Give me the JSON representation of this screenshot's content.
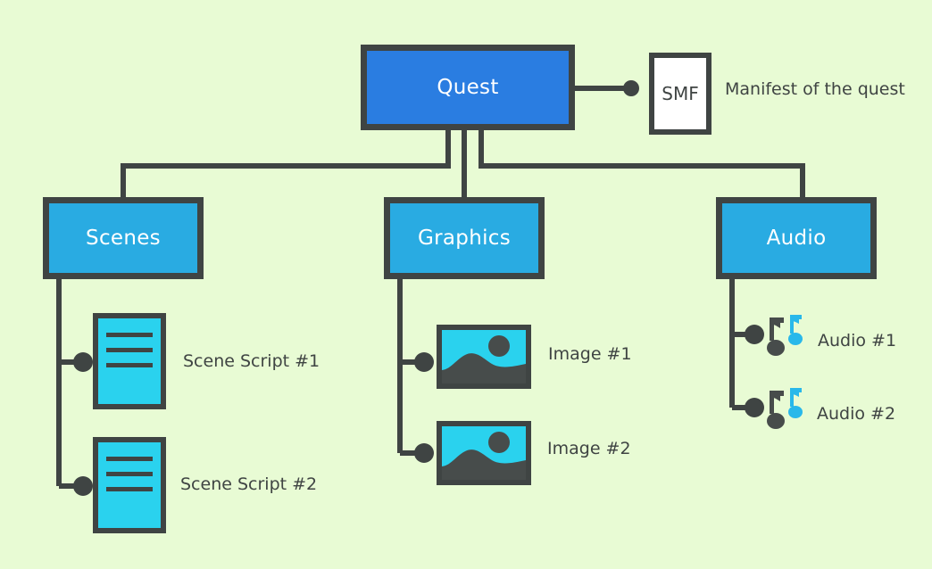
{
  "diagram": {
    "background_color": "#e8fbd4",
    "line_color": "#3f4443",
    "root": {
      "label": "Quest",
      "color": "#2a7de1"
    },
    "manifest": {
      "box_label": "SMF",
      "box_color": "#ffffff",
      "caption": "Manifest of the quest"
    },
    "branches": [
      {
        "label": "Scenes",
        "color": "#29abe2",
        "children": [
          {
            "icon": "document-icon",
            "label": "Scene Script #1"
          },
          {
            "icon": "document-icon",
            "label": "Scene Script #2"
          }
        ]
      },
      {
        "label": "Graphics",
        "color": "#29abe2",
        "children": [
          {
            "icon": "image-icon",
            "label": "Image #1"
          },
          {
            "icon": "image-icon",
            "label": "Image #2"
          }
        ]
      },
      {
        "label": "Audio",
        "color": "#29abe2",
        "children": [
          {
            "icon": "music-note-icon",
            "label": "Audio #1"
          },
          {
            "icon": "music-note-icon",
            "label": "Audio #2"
          }
        ]
      }
    ]
  }
}
